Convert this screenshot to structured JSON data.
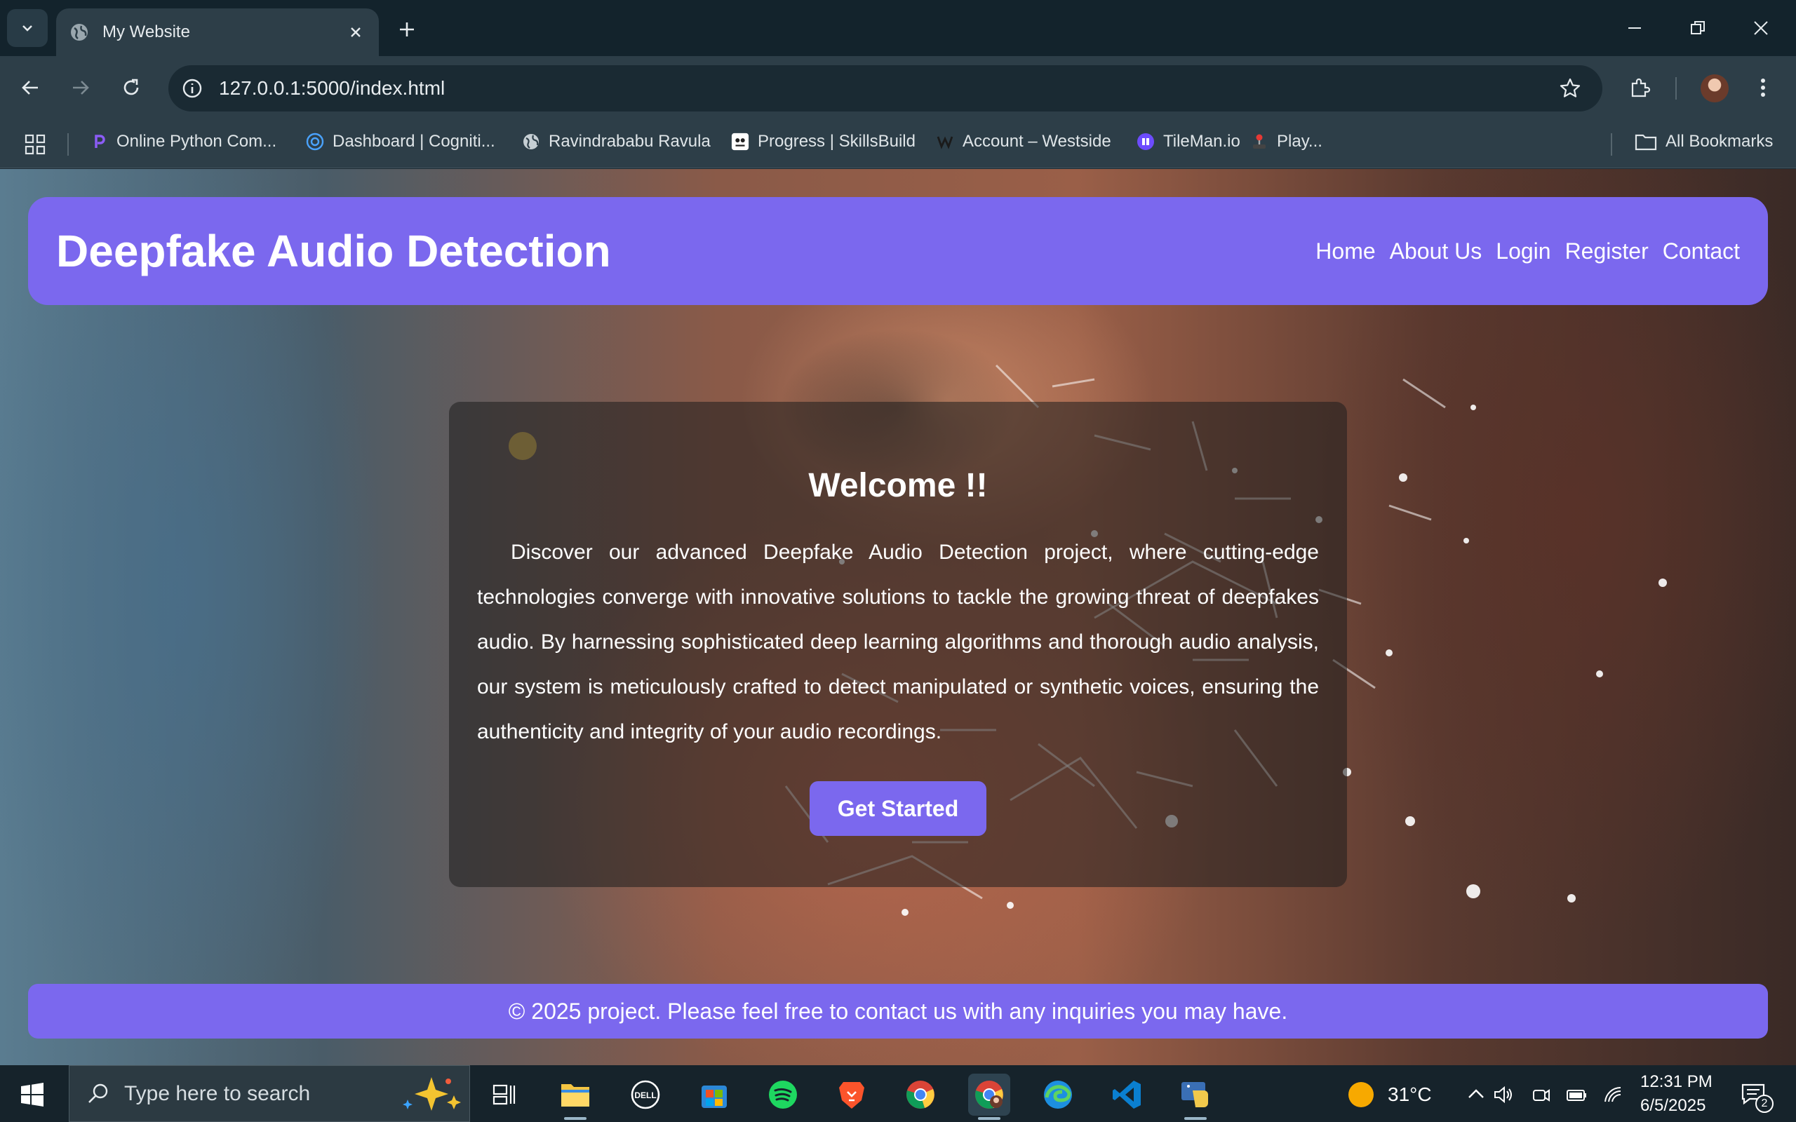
{
  "browser": {
    "tab": {
      "title": "My Website"
    },
    "url": "127.0.0.1:5000/index.html",
    "bookmarks": [
      {
        "label": "Online Python Com...",
        "icon": "python-compiler-icon"
      },
      {
        "label": "Dashboard | Cogniti...",
        "icon": "cognitive-class-icon"
      },
      {
        "label": "Ravindrababu Ravula",
        "icon": "globe-icon"
      },
      {
        "label": "Progress | SkillsBuild",
        "icon": "skillsbuild-icon"
      },
      {
        "label": "Account – Westside",
        "icon": "westside-icon"
      },
      {
        "label": "TileMan.io",
        "icon": "tileman-icon"
      },
      {
        "label": "Play...",
        "icon": "joystick-icon"
      }
    ],
    "all_bookmarks": "All Bookmarks"
  },
  "page": {
    "header": {
      "title": "Deepfake Audio Detection",
      "nav": [
        "Home",
        "About Us",
        "Login",
        "Register",
        "Contact"
      ]
    },
    "welcome": {
      "title": "Welcome !!",
      "text": "Discover our advanced Deepfake Audio Detection project, where cutting-edge technologies converge with innovative solutions to tackle the growing threat of deepfakes audio. By harnessing sophisticated deep learning algorithms and thorough audio analysis, our system is meticulously crafted to detect manipulated or synthetic voices, ensuring the authenticity and integrity of your audio recordings.",
      "button": "Get Started"
    },
    "footer": "© 2025 project. Please feel free to contact us with any inquiries you may have."
  },
  "taskbar": {
    "search_placeholder": "Type here to search",
    "weather": "31°C",
    "time": "12:31 PM",
    "date": "6/5/2025",
    "notifications": "2"
  },
  "colors": {
    "accent": "#7b68ee",
    "chrome_dark": "#13232c",
    "chrome": "#2d3e48"
  }
}
